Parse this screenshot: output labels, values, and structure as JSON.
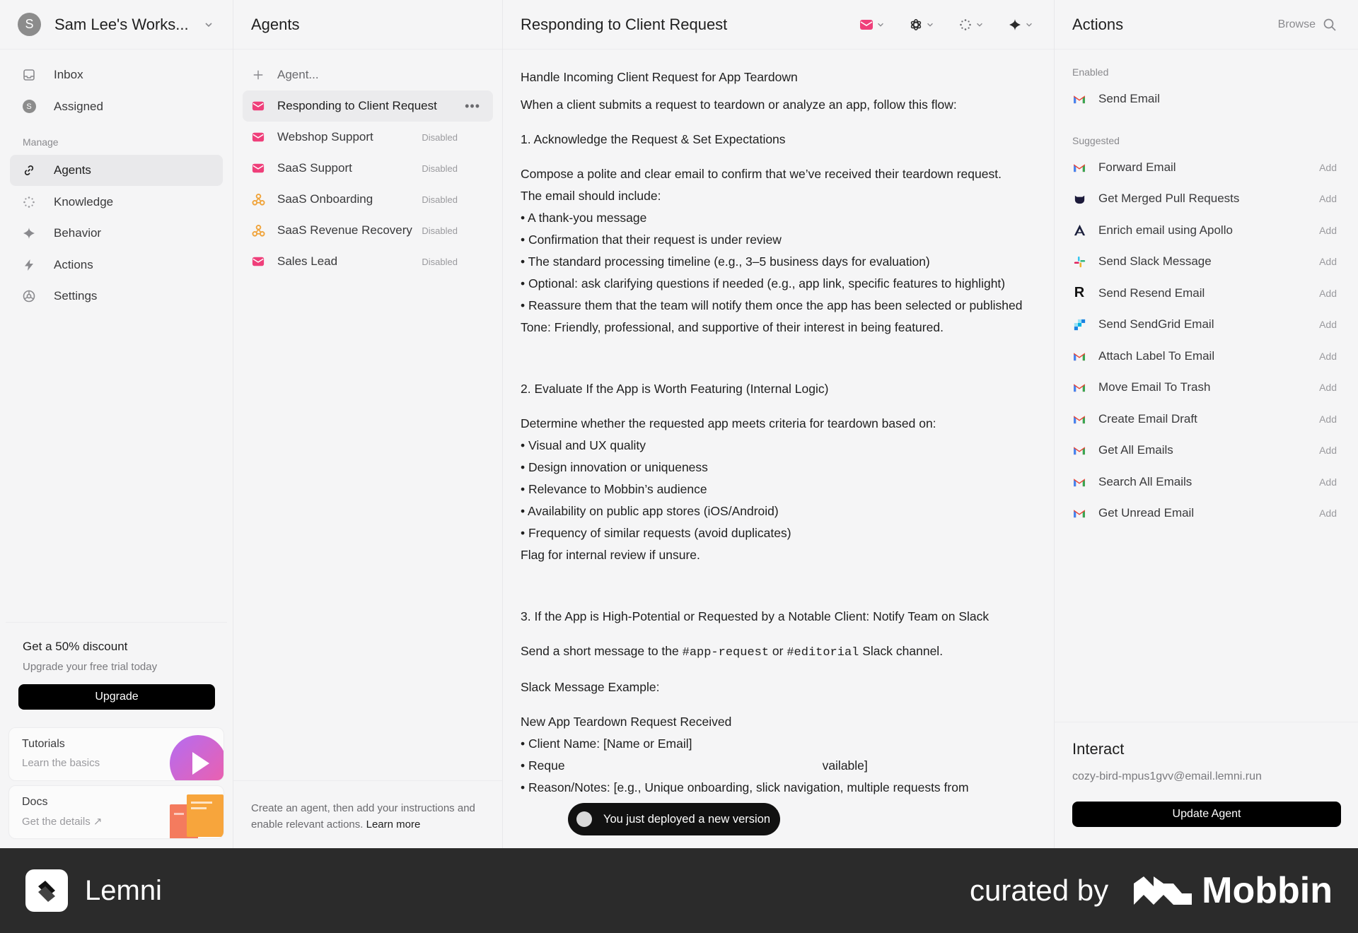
{
  "workspace": {
    "avatar": "S",
    "name": "Sam Lee's Works..."
  },
  "nav": {
    "inbox": "Inbox",
    "assigned": "Assigned",
    "assigned_avatar": "S",
    "manage_label": "Manage",
    "agents": "Agents",
    "knowledge": "Knowledge",
    "behavior": "Behavior",
    "actions": "Actions",
    "settings": "Settings"
  },
  "promo": {
    "title": "Get a 50% discount",
    "subtitle": "Upgrade your free trial today",
    "button": "Upgrade"
  },
  "cards": {
    "tutorials": {
      "title": "Tutorials",
      "subtitle": "Learn the basics"
    },
    "docs": {
      "title": "Docs",
      "subtitle": "Get the details ↗"
    }
  },
  "agents_panel": {
    "title": "Agents",
    "add_label": "Agent...",
    "items": [
      {
        "name": "Responding to Client Request",
        "status": "",
        "icon": "email-icon"
      },
      {
        "name": "Webshop Support",
        "status": "Disabled",
        "icon": "email-icon"
      },
      {
        "name": "SaaS Support",
        "status": "Disabled",
        "icon": "email-icon"
      },
      {
        "name": "SaaS Onboarding",
        "status": "Disabled",
        "icon": "webhook-icon"
      },
      {
        "name": "SaaS Revenue Recovery",
        "status": "Disabled",
        "icon": "webhook-icon"
      },
      {
        "name": "Sales Lead",
        "status": "Disabled",
        "icon": "email-icon"
      }
    ],
    "footer_text": "Create an agent, then add your instructions and enable relevant actions.",
    "footer_link": "Learn more"
  },
  "editor": {
    "title": "Responding to Client Request",
    "heading": "Handle Incoming Client Request for App Teardown",
    "intro": "When a client submits a request to teardown or analyze an app, follow this flow:",
    "s1_title": "1. Acknowledge the Request & Set Expectations",
    "s1_body": "Compose a polite and clear email to confirm that we’ve received their teardown request.",
    "s1_include": "The email should include:",
    "s1_bullets": [
      "• A thank-you message",
      "• Confirmation that their request is under review",
      "• The standard processing timeline (e.g., 3–5 business days for evaluation)",
      "• Optional: ask clarifying questions if needed (e.g., app link, specific features to highlight)",
      "• Reassure them that the team will notify them once the app has been selected or published"
    ],
    "tone_label": "Tone:",
    "tone_text": " Friendly, professional, and supportive of their interest in being featured.",
    "s2_title": "2. Evaluate If the App is Worth Featuring (Internal Logic)",
    "s2_intro": "Determine whether the requested app meets criteria for teardown based on:",
    "s2_bullets": [
      "• Visual and UX quality",
      "• Design innovation or uniqueness",
      "• Relevance to Mobbin’s audience",
      "• Availability on public app stores (iOS/Android)",
      "• Frequency of similar requests (avoid duplicates)"
    ],
    "s2_flag": "Flag for internal review if unsure.",
    "s3_title": "3. If the App is High-Potential or Requested by a Notable Client: Notify Team on Slack",
    "s3_pre": "Send a short message to the ",
    "s3_ch1": "#app-request",
    "s3_mid": " or ",
    "s3_ch2": "#editorial",
    "s3_post": " Slack channel.",
    "example_label": "Slack Message Example:",
    "example_title": "New App Teardown Request Received",
    "client_label": "• Client Name:",
    "client_value": " [Name or Email]",
    "request_label": "• Reque",
    "request_value": "vailable]",
    "reason_label": "• Reason/Notes:",
    "reason_value": " [e.g., Unique onboarding, slick navigation, multiple requests from"
  },
  "toast": {
    "text": "You just deployed a new version"
  },
  "actions_panel": {
    "title": "Actions",
    "browse": "Browse",
    "enabled_label": "Enabled",
    "enabled": [
      {
        "name": "Send Email",
        "icon": "gmail-icon"
      }
    ],
    "suggested_label": "Suggested",
    "add_label": "Add",
    "suggested": [
      {
        "name": "Forward Email",
        "icon": "gmail-icon"
      },
      {
        "name": "Get Merged Pull Requests",
        "icon": "github-icon"
      },
      {
        "name": "Enrich email using Apollo",
        "icon": "apollo-icon"
      },
      {
        "name": "Send Slack Message",
        "icon": "slack-icon"
      },
      {
        "name": "Send Resend Email",
        "icon": "resend-icon"
      },
      {
        "name": "Send SendGrid Email",
        "icon": "sendgrid-icon"
      },
      {
        "name": "Attach Label To Email",
        "icon": "gmail-icon"
      },
      {
        "name": "Move Email To Trash",
        "icon": "gmail-icon"
      },
      {
        "name": "Create Email Draft",
        "icon": "gmail-icon"
      },
      {
        "name": "Get All Emails",
        "icon": "gmail-icon"
      },
      {
        "name": "Search All Emails",
        "icon": "gmail-icon"
      },
      {
        "name": "Get Unread Email",
        "icon": "gmail-icon"
      }
    ]
  },
  "interact": {
    "title": "Interact",
    "email": "cozy-bird-mpus1gvv@email.lemni.run",
    "button": "Update Agent"
  },
  "banner": {
    "brand": "Lemni",
    "curated": "curated by",
    "mobbin": "Mobbin"
  },
  "colors": {
    "accent_pink": "#ef3f7a",
    "webhook_orange": "#f0a33a",
    "black": "#000000"
  }
}
